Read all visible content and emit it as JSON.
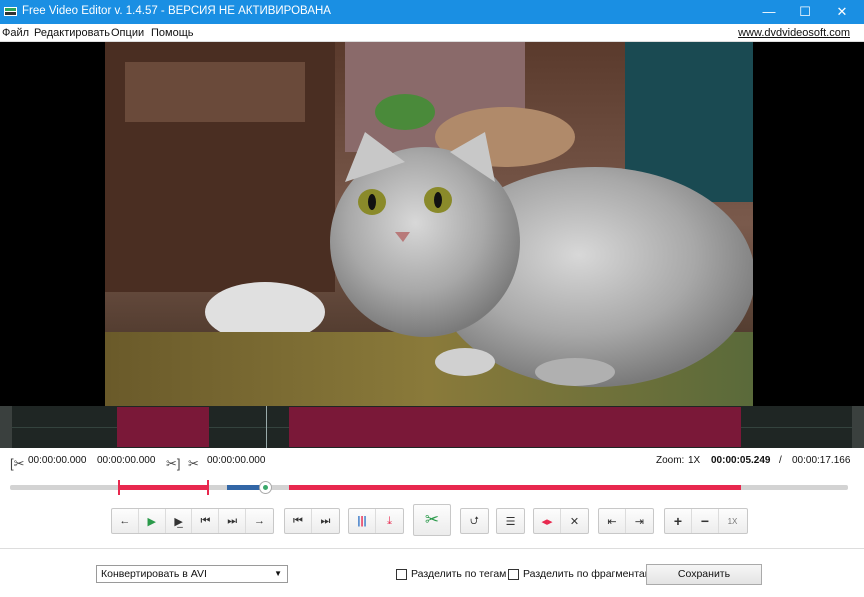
{
  "window": {
    "title": "Free Video Editor v. 1.4.57 - ВЕРСИЯ НЕ АКТИВИРОВАНА",
    "minimize": "—",
    "maximize": "☐",
    "close": "✕"
  },
  "menu": {
    "items": [
      "Файл",
      "Редактировать",
      "Опции",
      "Помощь"
    ],
    "site_link": "www.dvdvideosoft.com"
  },
  "timeline": {
    "sel_start": "00:00:00.000",
    "sel_end": "00:00:00.000",
    "cut_time": "00:00:00.000",
    "zoom_label": "Zoom:",
    "zoom_value": "1X",
    "current_time": "00:00:05.249",
    "separator": "/",
    "total_time": "00:00:17.166",
    "position_fraction": 0.306
  },
  "toolbar": {
    "zoom_reset": "1X"
  },
  "bottom": {
    "format_select": "Конвертировать в AVI",
    "split_tags": "Разделить по тегам",
    "split_fragments": "Разделить по фрагментам",
    "save": "Сохранить"
  },
  "colors": {
    "titlebar": "#1a8fe3",
    "cut_segment": "#7a1838",
    "accent_red": "#e8284e",
    "accent_green": "#3aa86a",
    "accent_blue": "#3266a6"
  }
}
